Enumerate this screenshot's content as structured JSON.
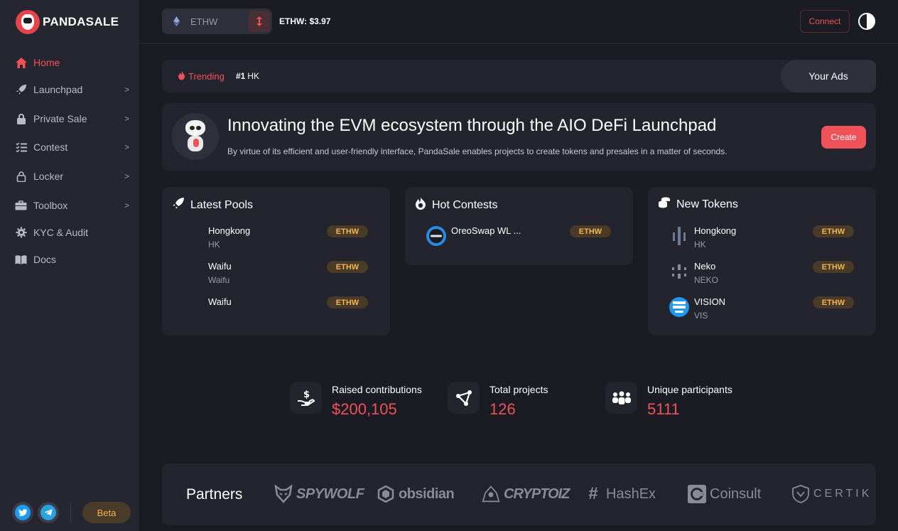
{
  "brand": {
    "name": "PANDASALE",
    "accent": "#f0525a"
  },
  "sidebar": {
    "items": [
      {
        "label": "Home",
        "icon": "home-icon",
        "active": true,
        "has_submenu": false
      },
      {
        "label": "Launchpad",
        "icon": "rocket-icon",
        "active": false,
        "has_submenu": true
      },
      {
        "label": "Private Sale",
        "icon": "lock-bag-icon",
        "active": false,
        "has_submenu": true
      },
      {
        "label": "Contest",
        "icon": "list-check-icon",
        "active": false,
        "has_submenu": true
      },
      {
        "label": "Locker",
        "icon": "lock-icon",
        "active": false,
        "has_submenu": true
      },
      {
        "label": "Toolbox",
        "icon": "toolbox-icon",
        "active": false,
        "has_submenu": true
      },
      {
        "label": "KYC & Audit",
        "icon": "gear-icon",
        "active": false,
        "has_submenu": false
      },
      {
        "label": "Docs",
        "icon": "book-icon",
        "active": false,
        "has_submenu": false
      }
    ],
    "chevron": ">",
    "beta_label": "Beta"
  },
  "header": {
    "chain_name": "ETHW",
    "price_text": "ETHW: $3.97",
    "connect_label": "Connect"
  },
  "trending": {
    "label": "Trending",
    "rank": "#1",
    "item": "HK",
    "ads_label": "Your Ads"
  },
  "hero": {
    "title": "Innovating the EVM ecosystem through the AIO DeFi Launchpad",
    "subtitle": "By virtue of its efficient and user-friendly interface, PandaSale enables projects to create tokens and presales in a matter of seconds.",
    "create_label": "Create"
  },
  "latest_pools": {
    "title": "Latest Pools",
    "rows": [
      {
        "name": "Hongkong",
        "symbol": "HK",
        "chain": "ETHW"
      },
      {
        "name": "Waifu",
        "symbol": "Waifu",
        "chain": "ETHW"
      },
      {
        "name": "Waifu",
        "symbol": "",
        "chain": "ETHW"
      }
    ]
  },
  "hot_contests": {
    "title": "Hot Contests",
    "rows": [
      {
        "name": "OreoSwap WL ...",
        "symbol": "",
        "chain": "ETHW"
      }
    ]
  },
  "new_tokens": {
    "title": "New Tokens",
    "rows": [
      {
        "name": "Hongkong",
        "symbol": "HK",
        "chain": "ETHW"
      },
      {
        "name": "Neko",
        "symbol": "NEKO",
        "chain": "ETHW"
      },
      {
        "name": "VISION",
        "symbol": "VIS",
        "chain": "ETHW"
      }
    ]
  },
  "stats": {
    "raised": {
      "label": "Raised contributions",
      "value": "$200,105"
    },
    "projects": {
      "label": "Total projects",
      "value": "126"
    },
    "participants": {
      "label": "Unique participants",
      "value": "5111"
    }
  },
  "partners": {
    "title": "Partners",
    "items": [
      "SPYWOLF",
      "obsidian",
      "CRYPTOIZ",
      "HashEx",
      "Coinsult",
      "CERTIK"
    ]
  }
}
